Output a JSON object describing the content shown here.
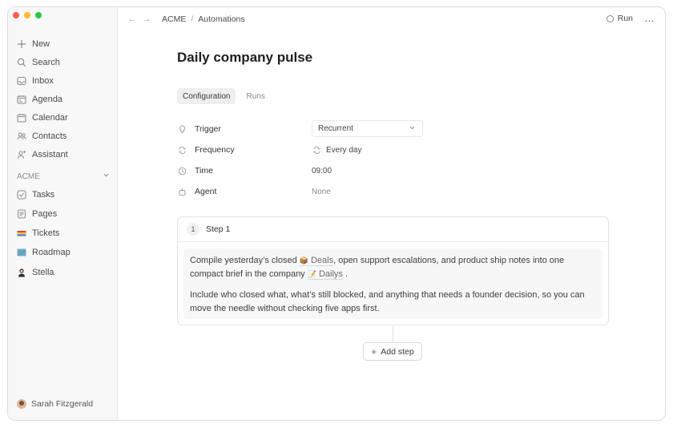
{
  "sidebar": {
    "items": [
      {
        "label": "New",
        "icon": "plus-icon"
      },
      {
        "label": "Search",
        "icon": "search-icon"
      },
      {
        "label": "Inbox",
        "icon": "inbox-icon"
      },
      {
        "label": "Agenda",
        "icon": "agenda-icon"
      },
      {
        "label": "Calendar",
        "icon": "calendar-icon"
      },
      {
        "label": "Contacts",
        "icon": "contacts-icon"
      },
      {
        "label": "Assistant",
        "icon": "assistant-icon"
      }
    ],
    "section_label": "ACME",
    "workspace_items": [
      {
        "label": "Tasks",
        "icon": "tasks-icon"
      },
      {
        "label": "Pages",
        "icon": "pages-icon"
      },
      {
        "label": "Tickets",
        "icon": "tickets-emoji"
      },
      {
        "label": "Roadmap",
        "icon": "roadmap-emoji"
      },
      {
        "label": "Stella",
        "icon": "stella-avatar"
      }
    ],
    "user_name": "Sarah Fitzgerald"
  },
  "topbar": {
    "breadcrumb": [
      "ACME",
      "Automations"
    ],
    "separator": "/",
    "run_label": "Run",
    "more_label": "…"
  },
  "page": {
    "title": "Daily company pulse",
    "tabs": [
      {
        "label": "Configuration",
        "active": true
      },
      {
        "label": "Runs",
        "active": false
      }
    ]
  },
  "properties": {
    "trigger": {
      "label": "Trigger",
      "value": "Recurrent"
    },
    "frequency": {
      "label": "Frequency",
      "value": "Every day"
    },
    "time": {
      "label": "Time",
      "value": "09:00"
    },
    "agent": {
      "label": "Agent",
      "value": "None"
    }
  },
  "step": {
    "number": "1",
    "title": "Step 1",
    "p1_a": "Compile yesterday’s closed ",
    "chip_deals": "Deals",
    "p1_b": ", open support escalations, and product ship notes into one compact brief in the company ",
    "chip_dailys": "Dailys",
    "p1_c": " .",
    "p2": "Include who closed what, what’s still blocked, and anything that needs a founder decision, so you can move the needle without checking five apps first."
  },
  "add_step_label": "Add step"
}
